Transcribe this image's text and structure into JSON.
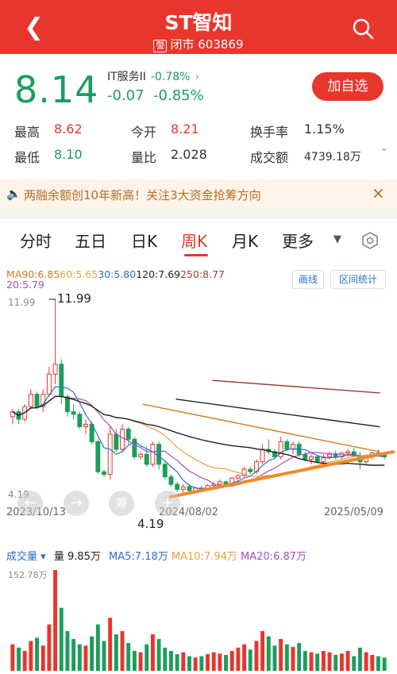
{
  "header": {
    "title": "ST智知",
    "badge": "警",
    "status": "闭市",
    "code": "603869"
  },
  "quote": {
    "price": "8.14",
    "sector_name": "IT服务II",
    "sector_pct": "-0.78%",
    "change": "-0.07",
    "change_pct": "-0.85%",
    "add_label": "加自选"
  },
  "stats": {
    "high_label": "最高",
    "high": "8.62",
    "open_label": "今开",
    "open": "8.21",
    "turnover_label": "换手率",
    "turnover": "1.15%",
    "low_label": "最低",
    "low": "8.10",
    "ratio_label": "量比",
    "ratio": "2.028",
    "amount_label": "成交额",
    "amount": "4739.18万"
  },
  "banner": {
    "text": "两融余额创10年新高！关注3大资金抢筹方向"
  },
  "tabs": [
    "分时",
    "五日",
    "日K",
    "周K",
    "月K",
    "更多"
  ],
  "active_tab": "周K",
  "ma": {
    "ma90": "MA90:6.85",
    "ma60": "60:5.65",
    "ma30": "30:5.80",
    "ma120": "120:7.69",
    "ma250": "250:8.77",
    "ma20": "20:5.79",
    "draw_label": "画线",
    "range_label": "区间统计"
  },
  "colors": {
    "up": "#e8362d",
    "down": "#1b9e5c",
    "ma5": "#2f6ec7",
    "ma10": "#e8a23a",
    "ma20": "#a24fc4",
    "ma60": "#e8a23a",
    "ma90": "#d27a2a",
    "ma120": "#222222",
    "ma250": "#9c3b2f",
    "trend": "#f08a2a"
  },
  "chart_data": {
    "type": "candlestick",
    "period": "weekly",
    "price_top_label": "11.99",
    "price_bottom_label": "4.19",
    "max_label": "11.99",
    "min_label": "4.19",
    "x_labels": [
      "2023/10/13",
      "2024/08/02",
      "2025/05/09"
    ],
    "candles": [
      [
        7.3,
        7.6,
        7.0,
        7.5
      ],
      [
        7.5,
        7.6,
        7.0,
        7.2
      ],
      [
        7.2,
        7.8,
        7.1,
        7.7
      ],
      [
        7.7,
        8.4,
        7.6,
        8.2
      ],
      [
        8.2,
        8.3,
        7.6,
        7.7
      ],
      [
        7.7,
        8.4,
        7.5,
        8.2
      ],
      [
        8.2,
        9.3,
        8.1,
        9.0
      ],
      [
        9.0,
        11.99,
        8.6,
        9.4
      ],
      [
        9.4,
        9.6,
        7.8,
        8.1
      ],
      [
        8.1,
        8.2,
        7.3,
        7.5
      ],
      [
        7.5,
        7.8,
        7.2,
        7.4
      ],
      [
        7.4,
        7.5,
        6.8,
        6.9
      ],
      [
        6.9,
        7.2,
        6.6,
        7.0
      ],
      [
        7.0,
        7.1,
        6.2,
        6.3
      ],
      [
        6.3,
        6.4,
        5.0,
        5.1
      ],
      [
        5.1,
        5.2,
        4.9,
        5.0
      ],
      [
        5.0,
        6.9,
        4.8,
        6.6
      ],
      [
        6.6,
        6.8,
        5.9,
        6.0
      ],
      [
        6.0,
        7.0,
        5.9,
        6.8
      ],
      [
        6.8,
        6.9,
        6.2,
        6.4
      ],
      [
        6.4,
        6.5,
        5.6,
        5.7
      ],
      [
        5.7,
        5.9,
        5.6,
        5.8
      ],
      [
        5.8,
        6.1,
        5.3,
        5.4
      ],
      [
        5.4,
        6.3,
        5.3,
        6.2
      ],
      [
        6.2,
        6.3,
        5.2,
        5.4
      ],
      [
        5.4,
        5.5,
        4.8,
        4.9
      ],
      [
        4.9,
        5.0,
        4.5,
        4.6
      ],
      [
        4.6,
        4.7,
        4.3,
        4.4
      ],
      [
        4.4,
        4.6,
        4.19,
        4.5
      ],
      [
        4.5,
        4.6,
        4.3,
        4.35
      ],
      [
        4.35,
        4.5,
        4.25,
        4.45
      ],
      [
        4.45,
        4.55,
        4.3,
        4.4
      ],
      [
        4.4,
        4.6,
        4.35,
        4.55
      ],
      [
        4.55,
        4.7,
        4.4,
        4.6
      ],
      [
        4.6,
        4.8,
        4.5,
        4.7
      ],
      [
        4.7,
        4.75,
        4.5,
        4.55
      ],
      [
        4.55,
        4.9,
        4.5,
        4.85
      ],
      [
        4.85,
        5.0,
        4.7,
        4.95
      ],
      [
        4.95,
        5.3,
        4.9,
        5.2
      ],
      [
        5.2,
        5.3,
        5.0,
        5.1
      ],
      [
        5.1,
        5.6,
        5.0,
        5.5
      ],
      [
        5.5,
        6.2,
        5.4,
        6.0
      ],
      [
        6.0,
        6.4,
        5.8,
        5.9
      ],
      [
        5.9,
        6.0,
        5.6,
        5.7
      ],
      [
        5.7,
        6.5,
        5.6,
        6.3
      ],
      [
        6.3,
        6.4,
        5.9,
        6.0
      ],
      [
        6.0,
        6.3,
        5.8,
        6.2
      ],
      [
        6.2,
        6.3,
        5.7,
        5.8
      ],
      [
        5.8,
        5.9,
        5.5,
        5.6
      ],
      [
        5.6,
        5.8,
        5.4,
        5.7
      ],
      [
        5.7,
        5.75,
        5.45,
        5.5
      ],
      [
        5.5,
        5.8,
        5.4,
        5.7
      ],
      [
        5.7,
        5.9,
        5.6,
        5.8
      ],
      [
        5.8,
        5.95,
        5.6,
        5.7
      ],
      [
        5.7,
        5.9,
        5.6,
        5.85
      ],
      [
        5.85,
        6.0,
        5.7,
        5.9
      ],
      [
        5.9,
        6.05,
        5.7,
        5.75
      ],
      [
        5.75,
        5.9,
        5.2,
        5.5
      ],
      [
        5.5,
        5.8,
        5.4,
        5.7
      ],
      [
        5.7,
        5.9,
        5.6,
        5.85
      ],
      [
        5.85,
        6.0,
        5.7,
        5.8
      ],
      [
        5.8,
        5.9,
        5.6,
        5.7
      ]
    ]
  },
  "volume": {
    "label": "成交量",
    "amount": "量 9.85万",
    "ma5": "MA5:7.18万",
    "ma10": "MA10:7.94万",
    "ma20": "MA20:6.87万",
    "top_label": "152.78万",
    "values": [
      40,
      35,
      30,
      45,
      50,
      38,
      70,
      152,
      95,
      60,
      48,
      40,
      38,
      52,
      70,
      45,
      80,
      55,
      60,
      42,
      30,
      28,
      40,
      55,
      48,
      35,
      30,
      25,
      28,
      22,
      20,
      22,
      25,
      28,
      26,
      24,
      30,
      35,
      40,
      32,
      45,
      60,
      52,
      38,
      48,
      40,
      36,
      42,
      30,
      28,
      26,
      30,
      28,
      24,
      26,
      30,
      22,
      35,
      28,
      24,
      22,
      20
    ]
  }
}
